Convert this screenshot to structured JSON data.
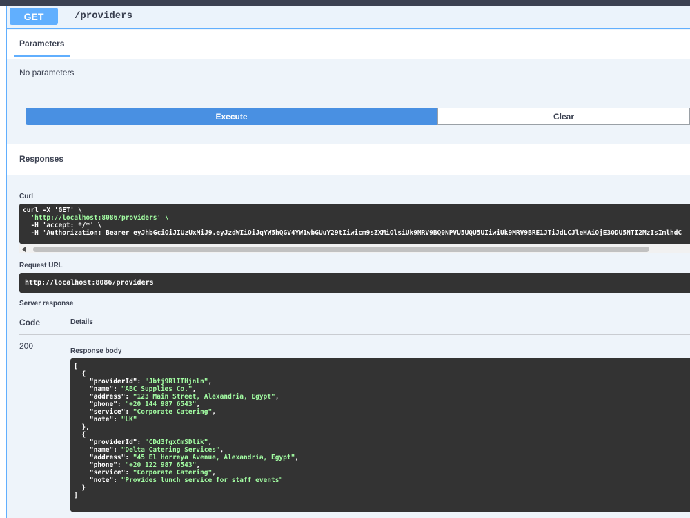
{
  "header": {
    "method": "GET",
    "path": "/providers"
  },
  "parameters": {
    "tab_label": "Parameters",
    "empty_text": "No parameters"
  },
  "actions": {
    "execute_label": "Execute",
    "clear_label": "Clear"
  },
  "responses": {
    "title": "Responses",
    "curl_label": "Curl",
    "curl_lines": [
      "curl -X 'GET' \\",
      "  'http://localhost:8086/providers' \\",
      "  -H 'accept: */*' \\",
      "  -H 'Authorization: Bearer eyJhbGciOiJIUzUxMiJ9.eyJzdWIiOiJqYW5hQGV4YW1wbGUuY29tIiwicm9sZXMiOlsiUk9MRV9BQ0NPVU5UQU5UIiwiUk9MRV9BRE1JTiJdLCJleHAiOjE3ODU5NTI2MzIsImlhdC"
    ],
    "request_url_label": "Request URL",
    "request_url": "http://localhost:8086/providers",
    "server_response_label": "Server response",
    "code_header": "Code",
    "details_header": "Details",
    "status_code": "200",
    "response_body_label": "Response body",
    "response_body": [
      {
        "providerId": "Jbtj9RlITHjnln",
        "name": "ABC Supplies Co.",
        "address": "123 Main Street, Alexandria, Egypt",
        "phone": "+20 144 987 6543",
        "service": "Corporate Catering",
        "note": "LK"
      },
      {
        "providerId": "CDd3fgxCmSDlik",
        "name": "Delta Catering Services",
        "address": "45 El Horreya Avenue, Alexandria, Egypt",
        "phone": "+20 122 987 6543",
        "service": "Corporate Catering",
        "note": "Provides lunch service for staff events"
      }
    ]
  },
  "colors": {
    "accent": "#61affe",
    "execute": "#4990e2",
    "code_bg": "#333333",
    "string": "#a2fca2"
  }
}
